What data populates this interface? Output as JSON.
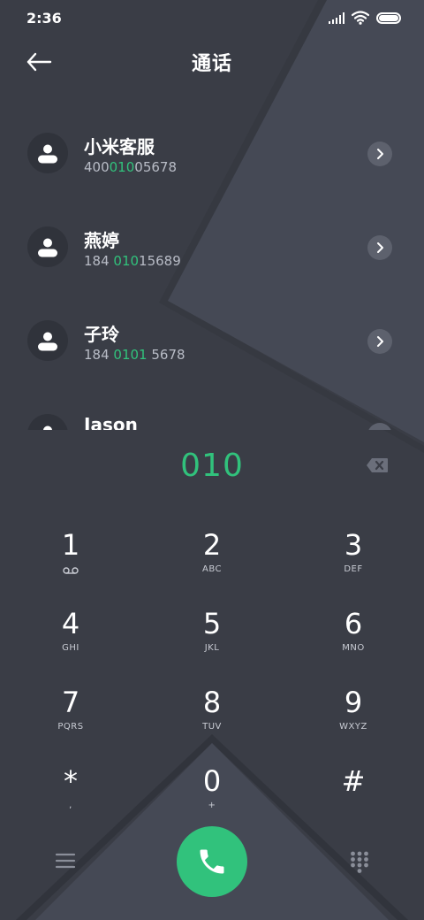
{
  "status_bar": {
    "time": "2:36",
    "icons": [
      "signal-icon",
      "wifi-icon",
      "battery-icon"
    ],
    "battery_level": 1.0
  },
  "header": {
    "title": "通话",
    "back_icon": "arrow-left-icon"
  },
  "contacts": [
    {
      "name": "小米客服",
      "number_pre": "400",
      "number_hl": "010",
      "number_post": "05678"
    },
    {
      "name": "燕婷",
      "number_pre": "184 ",
      "number_hl": "010",
      "number_post": "15689"
    },
    {
      "name": "子玲",
      "number_pre": "184 ",
      "number_hl": "0101",
      "number_post": " 5678"
    },
    {
      "name": "Jason",
      "number_pre": "",
      "number_hl": "",
      "number_post": ""
    }
  ],
  "dialer": {
    "number": "010",
    "keys": [
      {
        "digit": "1",
        "letters": ""
      },
      {
        "digit": "2",
        "letters": "ABC"
      },
      {
        "digit": "3",
        "letters": "DEF"
      },
      {
        "digit": "4",
        "letters": "GHI"
      },
      {
        "digit": "5",
        "letters": "JKL"
      },
      {
        "digit": "6",
        "letters": "MNO"
      },
      {
        "digit": "7",
        "letters": "PQRS"
      },
      {
        "digit": "8",
        "letters": "TUV"
      },
      {
        "digit": "9",
        "letters": "WXYZ"
      },
      {
        "digit": "*",
        "letters": ","
      },
      {
        "digit": "0",
        "letters": "+"
      },
      {
        "digit": "#",
        "letters": ""
      }
    ]
  },
  "colors": {
    "background": "#3a3d46",
    "accent": "#31c27c",
    "panel": "#454955"
  }
}
